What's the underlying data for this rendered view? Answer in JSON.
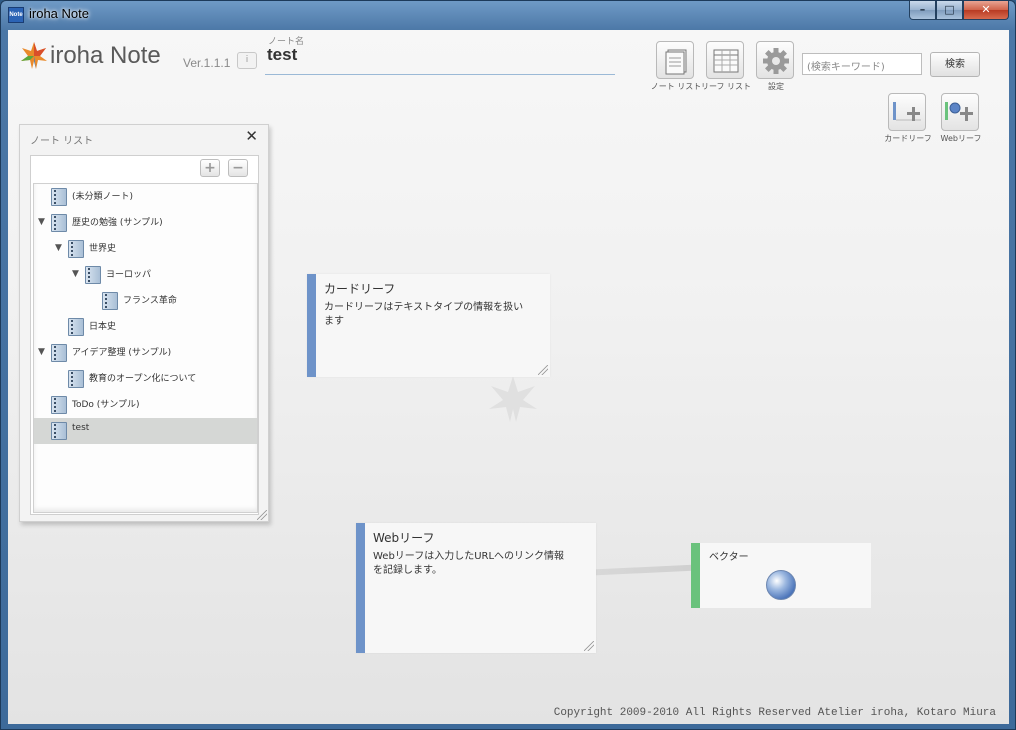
{
  "window": {
    "title": "iroha Note",
    "app_icon_text": "Note",
    "min_glyph": "–",
    "max_glyph": "□",
    "close_glyph": "✕"
  },
  "header": {
    "app_name": "iroha Note",
    "version": "Ver.1.1.1",
    "info_label": "i",
    "note_name_label": "ノート名",
    "note_name": "test"
  },
  "toolbar": {
    "note_list_label": "ノート リスト",
    "leaf_list_label": "リーフ リスト",
    "settings_label": "設定",
    "search_placeholder": "(検索キーワード)",
    "search_button": "検索",
    "card_leaf_label": "カードリーフ",
    "web_leaf_label": "Webリーフ"
  },
  "note_panel": {
    "title": "ノート リスト",
    "close": "✕",
    "add": "+",
    "remove": "−",
    "items": [
      {
        "label": "(未分類ノート)",
        "expanded": false,
        "selected": false
      },
      {
        "label": "歴史の勉強 (サンプル)",
        "expanded": true,
        "selected": false
      },
      {
        "label": "世界史",
        "expanded": true,
        "selected": false
      },
      {
        "label": "ヨーロッパ",
        "expanded": true,
        "selected": false
      },
      {
        "label": "フランス革命",
        "expanded": false,
        "selected": false
      },
      {
        "label": "日本史",
        "expanded": false,
        "selected": false
      },
      {
        "label": "アイデア整理 (サンプル)",
        "expanded": true,
        "selected": false
      },
      {
        "label": "教育のオープン化について",
        "expanded": false,
        "selected": false
      },
      {
        "label": "ToDo (サンプル)",
        "expanded": false,
        "selected": false
      },
      {
        "label": "test",
        "expanded": false,
        "selected": true
      }
    ]
  },
  "leaves": {
    "card": {
      "title": "カードリーフ",
      "body_line1": "カードリーフはテキストタイプの情報を扱い",
      "body_line2": "ます"
    },
    "web": {
      "title": "Webリーフ",
      "body_line1": "Webリーフは入力したURLへのリンク情報",
      "body_line2": "を記録します。"
    },
    "vector": {
      "title": "ベクター"
    }
  },
  "colors": {
    "card_bar": "#6e93c9",
    "vector_bar": "#6ac27c",
    "title_bar": "#4b77a6"
  },
  "footer": {
    "copyright": "Copyright 2009-2010 All Rights Reserved Atelier iroha, Kotaro Miura"
  }
}
